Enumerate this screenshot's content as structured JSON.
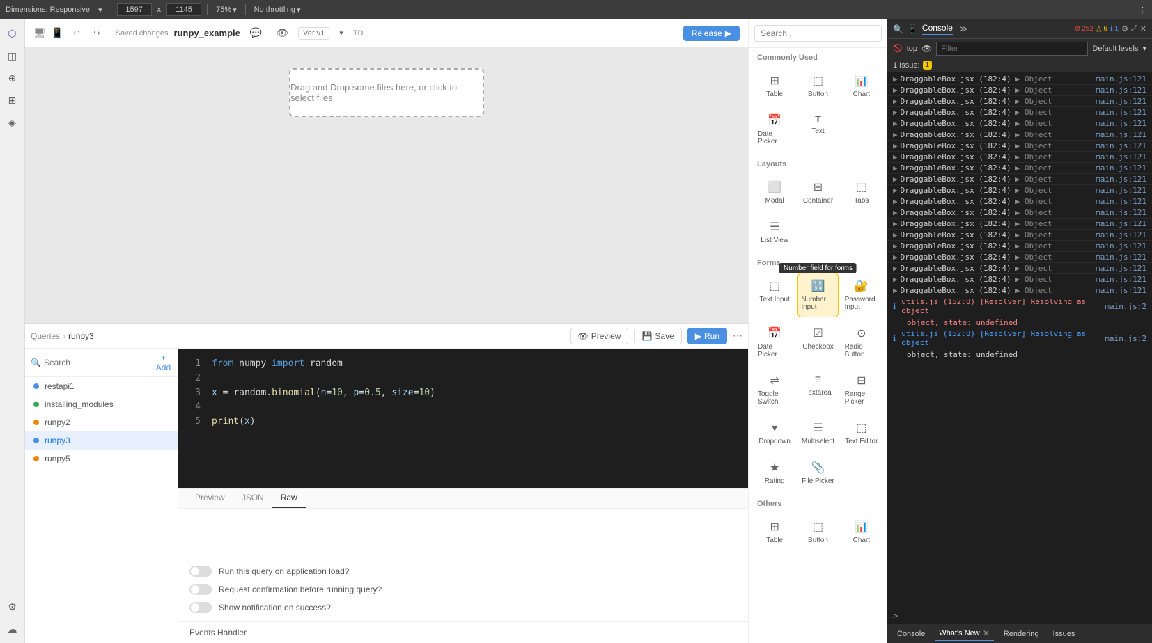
{
  "browser": {
    "dimensions_label": "Dimensions: Responsive",
    "width": "1597",
    "height": "1145",
    "zoom": "75%",
    "throttle": "No throttling",
    "separator_icon": "⋮"
  },
  "app": {
    "name": "runpy_example",
    "saved_text": "Saved changes",
    "version_label": "Ver  v1",
    "release_label": "Release",
    "td_label": "TD"
  },
  "sidebar": {
    "icons": [
      "⬡",
      "◫",
      "⊕",
      "⊞",
      "◈",
      "⚙",
      "☁"
    ]
  },
  "canvas": {
    "drop_zone_text": "Drag and Drop some files here, or click to select files"
  },
  "query_bar": {
    "breadcrumb": [
      "Queries",
      "runpy3"
    ],
    "preview_label": "Preview",
    "save_label": "Save",
    "run_label": "Run"
  },
  "nav": {
    "search_placeholder": "Search",
    "add_label": "+ Add",
    "items": [
      {
        "name": "restapi1",
        "color": "blue"
      },
      {
        "name": "installing_modules",
        "color": "green"
      },
      {
        "name": "runpy2",
        "color": "orange"
      },
      {
        "name": "runpy3",
        "color": "blue",
        "active": true
      },
      {
        "name": "runpy5",
        "color": "orange"
      }
    ]
  },
  "editor": {
    "lines": [
      {
        "num": "1",
        "code": "from numpy import random"
      },
      {
        "num": "2",
        "code": ""
      },
      {
        "num": "3",
        "code": "x = random.binomial(n=10, p=0.5, size=10)"
      },
      {
        "num": "4",
        "code": ""
      },
      {
        "num": "5",
        "code": "print(x)"
      }
    ]
  },
  "output": {
    "tabs": [
      "Preview",
      "JSON",
      "Raw"
    ],
    "active_tab": "Raw"
  },
  "settings": {
    "run_on_load": "Run this query on application load?",
    "confirm_before_run": "Request confirmation before running query?",
    "show_notification": "Show notification on success?"
  },
  "events_handler": "Events Handler",
  "right_panel": {
    "search_placeholder": "Search ,",
    "sections": {
      "commonly_used": {
        "label": "Commonly Used",
        "items": [
          {
            "icon": "⊞",
            "label": "Table"
          },
          {
            "icon": "⬚",
            "label": "Button"
          },
          {
            "icon": "📊",
            "label": "Chart"
          },
          {
            "icon": "📅",
            "label": "Date Picker"
          },
          {
            "icon": "T",
            "label": "Text"
          }
        ]
      },
      "layouts": {
        "label": "Layouts",
        "items": [
          {
            "icon": "⬜",
            "label": "Modal"
          },
          {
            "icon": "⊞",
            "label": "Container"
          },
          {
            "icon": "⬚",
            "label": "Tabs"
          },
          {
            "icon": "☰",
            "label": "List View"
          }
        ]
      },
      "forms": {
        "label": "Forms",
        "items": [
          {
            "icon": "⬚",
            "label": "Text Input"
          },
          {
            "icon": "🔢",
            "label": "Number Input",
            "tooltip": "Number field for forms"
          },
          {
            "icon": "🔐",
            "label": "Password Input"
          },
          {
            "icon": "📅",
            "label": "Date Picker"
          },
          {
            "icon": "☑",
            "label": "Checkbox"
          },
          {
            "icon": "⊙",
            "label": "Radio Button"
          },
          {
            "icon": "⇌",
            "label": "Toggle Switch"
          },
          {
            "icon": "≡",
            "label": "Textarea"
          },
          {
            "icon": "⊟",
            "label": "Range Picker"
          },
          {
            "icon": "▾",
            "label": "Dropdown"
          },
          {
            "icon": "☰",
            "label": "Multiselect"
          },
          {
            "icon": "⬚",
            "label": "Text Editor"
          },
          {
            "icon": "★",
            "label": "Rating"
          },
          {
            "icon": "📎",
            "label": "File Picker"
          }
        ]
      },
      "others": {
        "label": "Others",
        "items": [
          {
            "icon": "⊞",
            "label": "Table"
          },
          {
            "icon": "⬚",
            "label": "Button"
          },
          {
            "icon": "📊",
            "label": "Chart"
          }
        ]
      }
    }
  },
  "console": {
    "panel_title": "Console",
    "top_label": "top",
    "filter_placeholder": "Filter",
    "levels_label": "Default levels",
    "issues_count": "1 Issue:",
    "issues_badge": "1",
    "error_count": "252",
    "warn_count": "6",
    "info_count": "1",
    "rows": [
      {
        "source": "DraggableBox.jsx (182:4)",
        "value": "Object",
        "file": "main.js:121"
      },
      {
        "source": "DraggableBox.jsx (182:4)",
        "value": "Object",
        "file": "main.js:121"
      },
      {
        "source": "DraggableBox.jsx (182:4)",
        "value": "Object",
        "file": "main.js:121"
      },
      {
        "source": "DraggableBox.jsx (182:4)",
        "value": "Object",
        "file": "main.js:121"
      },
      {
        "source": "DraggableBox.jsx (182:4)",
        "value": "Object",
        "file": "main.js:121"
      },
      {
        "source": "DraggableBox.jsx (182:4)",
        "value": "Object",
        "file": "main.js:121"
      },
      {
        "source": "DraggableBox.jsx (182:4)",
        "value": "Object",
        "file": "main.js:121"
      },
      {
        "source": "DraggableBox.jsx (182:4)",
        "value": "Object",
        "file": "main.js:121"
      },
      {
        "source": "DraggableBox.jsx (182:4)",
        "value": "Object",
        "file": "main.js:121"
      },
      {
        "source": "DraggableBox.jsx (182:4)",
        "value": "Object",
        "file": "main.js:121"
      },
      {
        "source": "DraggableBox.jsx (182:4)",
        "value": "Object",
        "file": "main.js:121"
      },
      {
        "source": "DraggableBox.jsx (182:4)",
        "value": "Object",
        "file": "main.js:121"
      },
      {
        "source": "DraggableBox.jsx (182:4)",
        "value": "Object",
        "file": "main.js:121"
      },
      {
        "source": "DraggableBox.jsx (182:4)",
        "value": "Object",
        "file": "main.js:121"
      },
      {
        "source": "DraggableBox.jsx (182:4)",
        "value": "Object",
        "file": "main.js:121"
      },
      {
        "source": "DraggableBox.jsx (182:4)",
        "value": "Object",
        "file": "main.js:121"
      },
      {
        "source": "DraggableBox.jsx (182:4)",
        "value": "Object",
        "file": "main.js:121"
      },
      {
        "source": "DraggableBox.jsx (182:4)",
        "value": "Object",
        "file": "main.js:121"
      },
      {
        "source": "DraggableBox.jsx (182:4)",
        "value": "Object",
        "file": "main.js:121"
      },
      {
        "source": "DraggableBox.jsx (182:4)",
        "value": "Object",
        "file": "main.js:121"
      },
      {
        "source": "utils.js (152:8) [Resolver] Resolving as object main.js:2 object, state: undefined",
        "value": "",
        "file": "main.js:2",
        "type": "error"
      },
      {
        "source": "utils.js (152:8) [Resolver] Resolving as object main.js:2 object, state: undefined",
        "value": "",
        "file": "main.js:2",
        "type": "info"
      }
    ],
    "bottom_tabs": [
      "Console",
      "What's New",
      "Rendering",
      "Issues"
    ],
    "active_bottom_tab": "What's New",
    "prompt": ">"
  }
}
